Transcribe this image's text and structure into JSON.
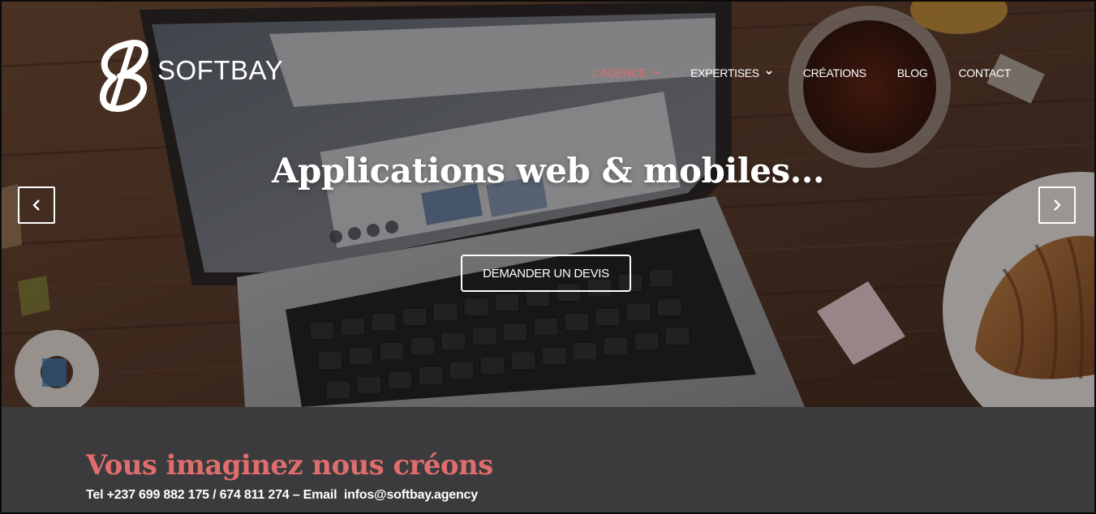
{
  "brand": {
    "name": "SOFTBAY"
  },
  "nav": {
    "items": [
      {
        "label": "L'AGENCE",
        "has_dropdown": true,
        "active": true
      },
      {
        "label": "EXPERTISES",
        "has_dropdown": true,
        "active": false
      },
      {
        "label": "CRÉATIONS",
        "has_dropdown": false,
        "active": false
      },
      {
        "label": "BLOG",
        "has_dropdown": false,
        "active": false
      },
      {
        "label": "CONTACT",
        "has_dropdown": false,
        "active": false
      }
    ]
  },
  "slider": {
    "title": "Applications web & mobiles...",
    "cta_label": "DEMANDER UN DEVIS",
    "prev_icon": "chevron-left-icon",
    "next_icon": "chevron-right-icon"
  },
  "band": {
    "tagline": "Vous imaginez nous créons",
    "contact": "Tel +237 699 882 175 / 674 811 274 – Email  infos@softbay.agency"
  },
  "colors": {
    "accent": "#e06d6d",
    "band_background": "#3b3b3d",
    "text_light": "#ffffff"
  }
}
